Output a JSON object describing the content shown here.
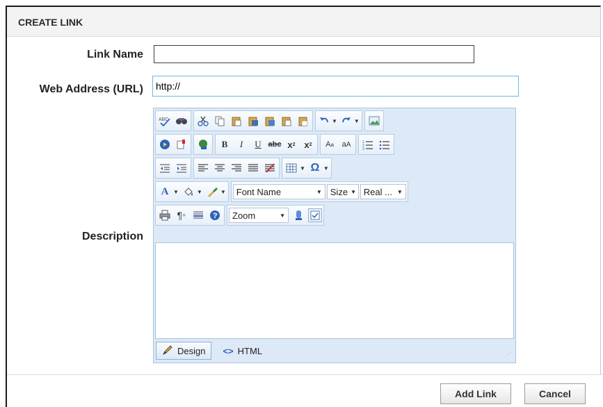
{
  "dialog": {
    "title": "CREATE LINK"
  },
  "form": {
    "link_name_label": "Link Name",
    "link_name_value": "",
    "url_label": "Web Address (URL)",
    "url_value": "http://",
    "description_label": "Description"
  },
  "editor": {
    "font_name": "Font Name",
    "font_size": "Size",
    "paragraph": "Real ...",
    "zoom": "Zoom",
    "design_label": "Design",
    "html_label": "HTML",
    "content": ""
  },
  "footer": {
    "add_label": "Add Link",
    "cancel_label": "Cancel"
  },
  "colors": {
    "editor_bg": "#dde9f6",
    "url_focus": "#69b7e8"
  }
}
